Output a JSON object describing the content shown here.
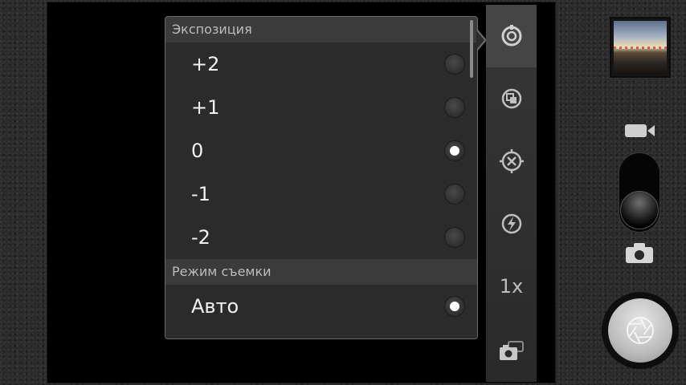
{
  "exposure_menu": {
    "header": "Экспозиция",
    "options": [
      {
        "label": "+2",
        "selected": false
      },
      {
        "label": "+1",
        "selected": false
      },
      {
        "label": "0",
        "selected": true
      },
      {
        "label": "-1",
        "selected": false
      },
      {
        "label": "-2",
        "selected": false
      }
    ]
  },
  "scene_menu": {
    "header": "Режим съемки",
    "options": [
      {
        "label": "Авто",
        "selected": true
      }
    ]
  },
  "toolbar": {
    "zoom_label": "1x",
    "icons": [
      "settings-icon",
      "scene-mode-icon",
      "focus-mode-icon",
      "flash-auto-icon",
      "camera-switch-icon"
    ]
  },
  "controls": {
    "mode_options": [
      "video-icon",
      "photo-icon"
    ],
    "active_mode": "photo"
  }
}
